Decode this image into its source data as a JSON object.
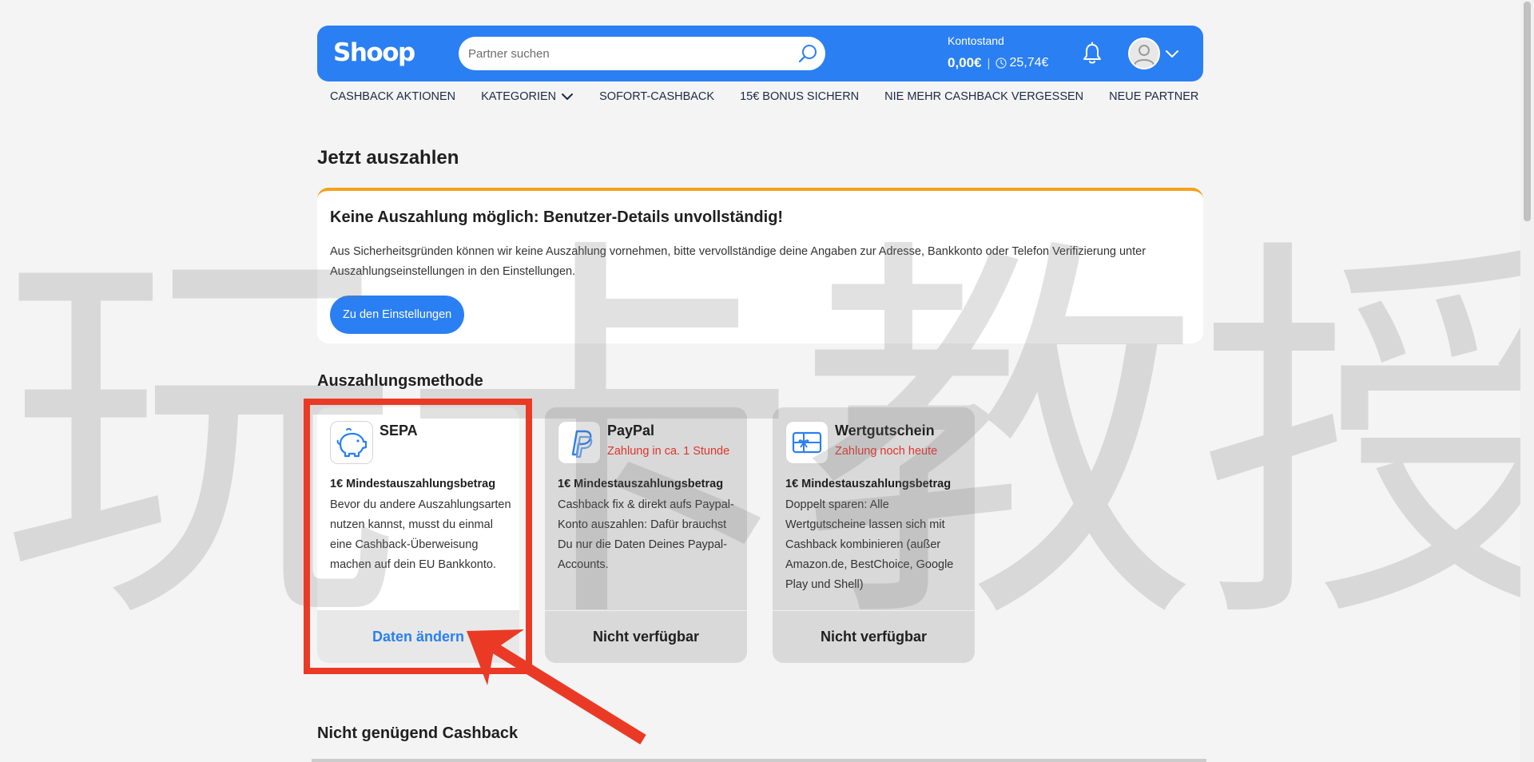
{
  "header": {
    "logo": "Shoop",
    "search_placeholder": "Partner suchen",
    "balance_label": "Kontostand",
    "balance_value": "0,00€",
    "balance_separator": "|",
    "pending_value": "25,74€",
    "accent_color": "#2a7ff3"
  },
  "nav": {
    "items": [
      {
        "label": "Cashback Aktionen"
      },
      {
        "label": "Kategorien"
      },
      {
        "label": "Sofort-Cashback"
      },
      {
        "label": "15€ Bonus sichern"
      },
      {
        "label": "Nie mehr Cashback vergessen"
      },
      {
        "label": "Neue Partner"
      }
    ]
  },
  "page_title": "Jetzt auszahlen",
  "alert": {
    "title": "Keine Auszahlung möglich: Benutzer-Details unvollständig!",
    "text": "Aus Sicherheitsgründen können wir keine Auszahlung vornehmen, bitte vervollständige deine Angaben zur Adresse, Bankkonto oder Telefon Verifizierung unter Auszahlungseinstellungen in den Einstellungen.",
    "button_label": "Zu den Einstellungen",
    "border_color": "#f4a11c"
  },
  "methods_title": "Auszahlungsmethode",
  "methods": [
    {
      "name": "SEPA",
      "icon": "piggy-bank-icon",
      "subtitle": "",
      "min_amount": "1€ Mindestauszahlungsbetrag",
      "description": "Bevor du andere Auszahlungsarten nutzen kannst, musst du einmal eine Cashback-Überweisung machen auf dein EU Bankkonto.",
      "action": "Daten ändern"
    },
    {
      "name": "PayPal",
      "icon": "paypal-icon",
      "subtitle": "Zahlung in ca. 1 Stunde",
      "min_amount": "1€ Mindestauszahlungsbetrag",
      "description": "Cashback fix & direkt aufs Paypal-Konto auszahlen: Dafür brauchst Du nur die Daten Deines Paypal-Accounts.",
      "action": "Nicht verfügbar"
    },
    {
      "name": "Wertgutschein",
      "icon": "gift-card-icon",
      "subtitle": "Zahlung noch heute",
      "min_amount": "1€ Mindestauszahlungsbetrag",
      "description": "Doppelt sparen: Alle Wertgutscheine lassen sich mit Cashback kombinieren (außer Amazon.de, BestChoice, Google Play und Shell)",
      "action": "Nicht verfügbar"
    }
  ],
  "insufficient_title": "Nicht genügend Cashback",
  "watermark": [
    "玩",
    "卡",
    "教",
    "授"
  ],
  "annotation_color": "#ea3a25"
}
